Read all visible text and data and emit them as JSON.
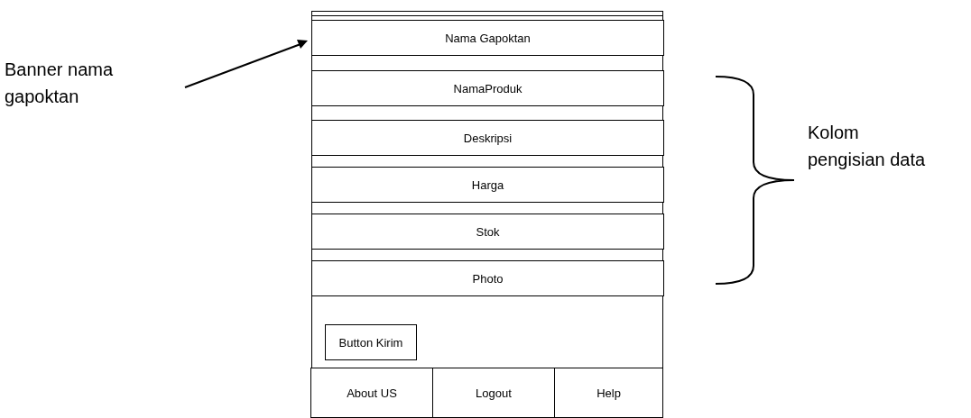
{
  "form_fields": [
    {
      "label": "Nama Gapoktan"
    },
    {
      "label": "NamaProduk"
    },
    {
      "label": "Deskripsi"
    },
    {
      "label": "Harga"
    },
    {
      "label": "Stok"
    },
    {
      "label": "Photo"
    }
  ],
  "submit_button": {
    "label": "Button Kirim"
  },
  "nav_items": [
    {
      "label": "About US"
    },
    {
      "label": "Logout"
    },
    {
      "label": "Help"
    }
  ],
  "annotations": [
    {
      "kind": "arrow",
      "lines": [
        "Banner nama",
        "gapoktan"
      ]
    },
    {
      "kind": "brace",
      "lines": [
        "Kolom",
        "pengisian data"
      ]
    }
  ]
}
